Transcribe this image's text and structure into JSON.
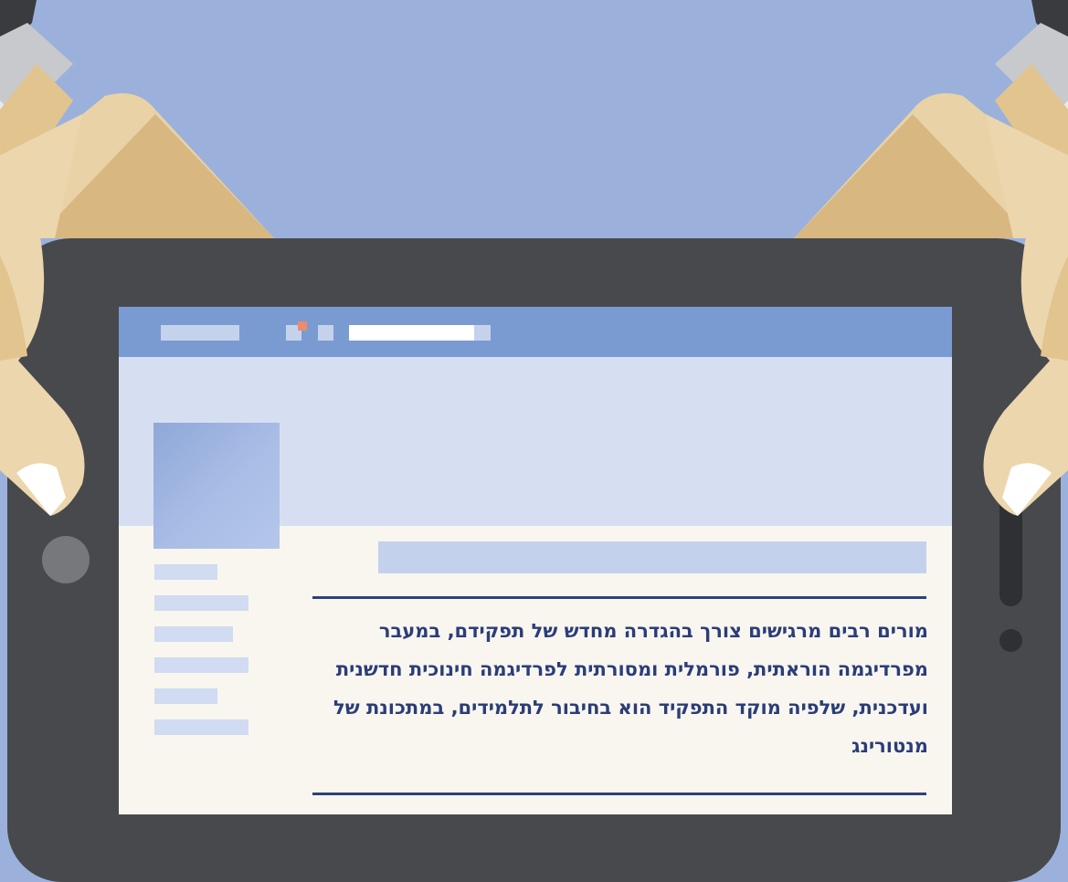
{
  "colors": {
    "background": "#9bb1dc",
    "tablet": "#48494c",
    "topbar": "#7a9bd2",
    "cover": "#d6dff2",
    "page": "#f8f6ef",
    "text": "#2b3d78",
    "rule": "#2d417c",
    "notification": "#ef8a6a"
  },
  "post": {
    "quote": "מורים רבים מרגישים צורך בהגדרה מחדש של תפקידם, במעבר מפרדיגמה הוראתית, פורמלית ומסורתית לפרדיגמה חינוכית חדשנית ועדכנית, שלפיה מוקד התפקיד הוא בחיבור לתלמידים, במתכונת של מנטורינג"
  }
}
